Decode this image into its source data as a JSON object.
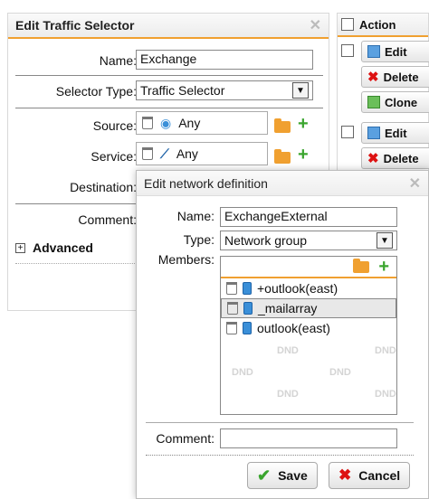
{
  "traffic_dialog": {
    "title": "Edit Traffic Selector",
    "name_label": "Name:",
    "name_value": "Exchange",
    "selector_type_label": "Selector Type:",
    "selector_type_value": "Traffic Selector",
    "source_label": "Source:",
    "source_value": "Any",
    "service_label": "Service:",
    "service_value": "Any",
    "destination_label": "Destination:",
    "comment_label": "Comment:",
    "advanced_label": "Advanced"
  },
  "action_panel": {
    "header": "Action",
    "edit_label": "Edit",
    "delete_label": "Delete",
    "clone_label": "Clone"
  },
  "network_dialog": {
    "title": "Edit network definition",
    "name_label": "Name:",
    "name_value": "ExchangeExternal",
    "type_label": "Type:",
    "type_value": "Network group",
    "members_label": "Members:",
    "members": [
      "+outlook(east)",
      "_mailarray",
      "outlook(east)"
    ],
    "dnd_text": "DND",
    "comment_label": "Comment:",
    "comment_value": "",
    "save_label": "Save",
    "cancel_label": "Cancel"
  },
  "colors": {
    "accent": "#f0a030",
    "add_green": "#3aa52e",
    "delete_red": "#dd1111",
    "network_blue": "#3a8fd8"
  }
}
